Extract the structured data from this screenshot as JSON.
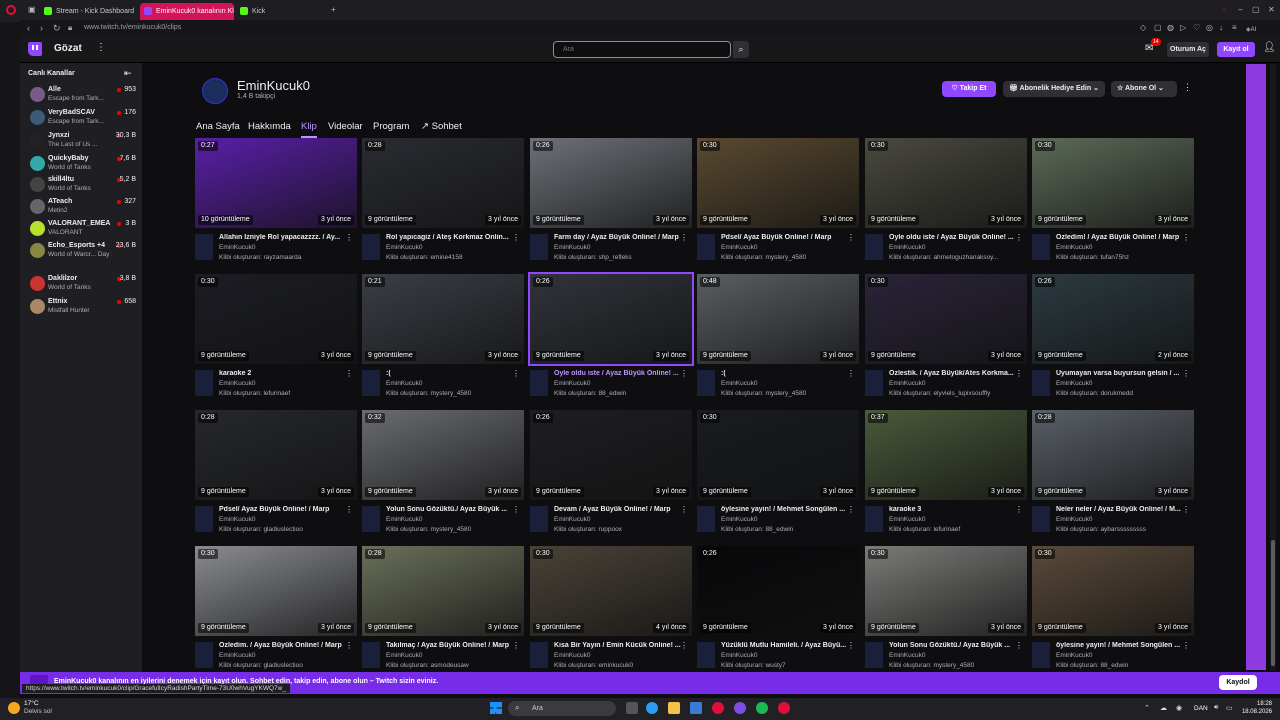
{
  "browser": {
    "tabs": [
      {
        "label": "Stream - Kick Dashboard",
        "color": "#53fc18"
      },
      {
        "label": "EminKucuk0 kanalının Klip",
        "color": "#9147ff",
        "active": true
      },
      {
        "label": "Kick",
        "color": "#53fc18"
      }
    ],
    "new_tab_icon": "+",
    "url": "www.twitch.tv/eminkucuk0/clips",
    "status_url": "https://www.twitch.tv/eminkucuk0/clip/GracefulIcyRadishPartyTime-73U0whVugYKWQ7w_"
  },
  "nav": {
    "browse_label": "Gözat",
    "search_placeholder": "Ara",
    "inbox_badge": "14",
    "login_label": "Oturum Aç",
    "signup_label": "Kayıt ol"
  },
  "sidebar": {
    "title": "Canlı Kanallar",
    "channels": [
      {
        "name": "Alle",
        "game": "Escape from Tark...",
        "viewers": "953",
        "color": "#7a5a8a"
      },
      {
        "name": "VeryBadSCAV",
        "game": "Escape from Tark...",
        "viewers": "176",
        "color": "#3c5a7a"
      },
      {
        "name": "Jynxzi",
        "game": "The Last of Us ...",
        "viewers": "30,3 B",
        "color": "#222"
      },
      {
        "name": "QuickyBaby",
        "game": "World of Tanks",
        "viewers": "7,6 B",
        "color": "#3aa"
      },
      {
        "name": "skill4ltu",
        "game": "World of Tanks",
        "viewers": "5,2 B",
        "color": "#444"
      },
      {
        "name": "ATeach",
        "game": "Metin2",
        "viewers": "327",
        "color": "#666"
      },
      {
        "name": "VALORANT_EMEA",
        "game": "VALORANT",
        "viewers": "3 B",
        "color": "#b6e22c"
      },
      {
        "name": "Echo_Esports +4",
        "game": "World of Warcr... Day 1 - The Ra...",
        "viewers": "23,6 B",
        "color": "#884"
      },
      {
        "name": "Daklilzor",
        "game": "World of Tanks",
        "viewers": "3,8 B",
        "color": "#c33"
      },
      {
        "name": "Ettnix",
        "game": "Mistfall Hunter",
        "viewers": "658",
        "color": "#a86"
      }
    ]
  },
  "channel": {
    "name": "EminKucuk0",
    "followers": "1,4 B takipçi",
    "follow_label": "Takip Et",
    "gift_label": "Abonelik Hediye Edin",
    "subscribe_label": "Abone Ol",
    "tabs": [
      "Ana Sayfa",
      "Hakkımda",
      "Klip",
      "Videolar",
      "Program",
      "Sohbet"
    ]
  },
  "clips": [
    {
      "dur": "0:27",
      "views": "10 görüntüleme",
      "age": "3 yıl önce",
      "title": "Allahın İzniyle Rol yapacazzzz. / Ay...",
      "channel": "EminKucuk0",
      "by": "Klibi oluşturan: rayzamaarda",
      "bg": "#5a1fa8"
    },
    {
      "dur": "0:28",
      "views": "9 görüntüleme",
      "age": "3 yıl önce",
      "title": "Rol yapıcagiz / Ateş Korkmaz Onlin...",
      "channel": "EminKucuk0",
      "by": "Klibi oluşturan: emine4158",
      "bg": "#2a2c32"
    },
    {
      "dur": "0:26",
      "views": "9 görüntüleme",
      "age": "3 yıl önce",
      "title": "Farm day / Ayaz Büyük Online! / Marp",
      "channel": "EminKucuk0",
      "by": "Klibi oluşturan: shp_refleks",
      "bg": "#6d7178"
    },
    {
      "dur": "0:30",
      "views": "9 görüntüleme",
      "age": "3 yıl önce",
      "title": "Pdsel/ Ayaz Büyük Online! / Marp",
      "channel": "EminKucuk0",
      "by": "Klibi oluşturan: mystery_4580",
      "bg": "#5a4a30"
    },
    {
      "dur": "0:30",
      "views": "9 görüntüleme",
      "age": "3 yıl önce",
      "title": "Öyle oldu iste / Ayaz Büyük Online! ...",
      "channel": "EminKucuk0",
      "by": "Klibi oluşturan: ahmetoguzhanaksoy...",
      "bg": "#4a4a40"
    },
    {
      "dur": "0:30",
      "views": "9 görüntüleme",
      "age": "3 yıl önce",
      "title": "Özledim! / Ayaz Büyük Online! / Marp",
      "channel": "EminKucuk0",
      "by": "Klibi oluşturan: tufan75hz",
      "bg": "#5c6a58"
    },
    {
      "dur": "0:30",
      "views": "9 görüntüleme",
      "age": "3 yıl önce",
      "title": "karaoke 2",
      "channel": "EminKucuk0",
      "by": "Klibi oluşturan: lefurinaef",
      "bg": "#1c1d24"
    },
    {
      "dur": "0:21",
      "views": "9 görüntüleme",
      "age": "3 yıl önce",
      "title": ":(",
      "channel": "EminKucuk0",
      "by": "Klibi oluşturan: mystery_4580",
      "bg": "#3a3e46"
    },
    {
      "dur": "0:26",
      "views": "9 görüntüleme",
      "age": "3 yıl önce",
      "title": "Öyle oldu iste / Ayaz Büyük Online! ...",
      "channel": "EminKucuk0",
      "by": "Klibi oluşturan: 88_edwin",
      "bg": "#30343a",
      "highlight": true
    },
    {
      "dur": "0:48",
      "views": "9 görüntüleme",
      "age": "3 yıl önce",
      "title": ":(",
      "channel": "EminKucuk0",
      "by": "Klibi oluşturan: mystery_4580",
      "bg": "#5a5e62"
    },
    {
      "dur": "0:30",
      "views": "9 görüntüleme",
      "age": "3 yıl önce",
      "title": "Özlestik. / Ayaz Büyük/Ates Korkma...",
      "channel": "EminKucuk0",
      "by": "Klibi oluşturan: elyviels_lupixsouffly",
      "bg": "#2a2438"
    },
    {
      "dur": "0:26",
      "views": "9 görüntüleme",
      "age": "2 yıl önce",
      "title": "Uyumayan varsa buyursun gelsin / ...",
      "channel": "EminKucuk0",
      "by": "Klibi oluşturan: dorukmedd",
      "bg": "#2c3a40"
    },
    {
      "dur": "0:28",
      "views": "9 görüntüleme",
      "age": "3 yıl önce",
      "title": "Pdsel/ Ayaz Büyük Online! / Marp",
      "channel": "EminKucuk0",
      "by": "Klibi oluşturan: gladiuslectioo",
      "bg": "#26282c"
    },
    {
      "dur": "0:32",
      "views": "9 görüntüleme",
      "age": "3 yıl önce",
      "title": "Yolun Sonu Gözüktü./ Ayaz Büyük ...",
      "channel": "EminKucuk0",
      "by": "Klibi oluşturan: mystery_4580",
      "bg": "#6a6c70"
    },
    {
      "dur": "0:26",
      "views": "9 görüntüleme",
      "age": "3 yıl önce",
      "title": "Devam / Ayaz Büyük Online! / Marp",
      "channel": "EminKucuk0",
      "by": "Klibi oluşturan: ruppoox",
      "bg": "#1e1e22"
    },
    {
      "dur": "0:30",
      "views": "9 görüntüleme",
      "age": "3 yıl önce",
      "title": "öylesine yayin! / Mehmet Songülen ...",
      "channel": "EminKucuk0",
      "by": "Klibi oluşturan: 88_edwin",
      "bg": "#181c20"
    },
    {
      "dur": "0:37",
      "views": "9 görüntüleme",
      "age": "3 yıl önce",
      "title": "karaoke 3",
      "channel": "EminKucuk0",
      "by": "Klibi oluşturan: lefurinaef",
      "bg": "#4a5a3a"
    },
    {
      "dur": "0:28",
      "views": "9 görüntüleme",
      "age": "3 yıl önce",
      "title": "Neler neler / Ayaz Büyük Online! / M...",
      "channel": "EminKucuk0",
      "by": "Klibi oluşturan: aybarsssssssss",
      "bg": "#5a6068"
    },
    {
      "dur": "0:30",
      "views": "9 görüntüleme",
      "age": "3 yıl önce",
      "title": "Özledim. / Ayaz Büyük Online! / Marp",
      "channel": "EminKucuk0",
      "by": "Klibi oluşturan: gladiuslectioo",
      "bg": "#8a8c90"
    },
    {
      "dur": "0:28",
      "views": "9 görüntüleme",
      "age": "3 yıl önce",
      "title": "Takılmaç / Ayaz Büyük Online! / Marp",
      "channel": "EminKucuk0",
      "by": "Klibi oluşturan: asmodeusaw",
      "bg": "#6a705a"
    },
    {
      "dur": "0:30",
      "views": "9 görüntüleme",
      "age": "4 yıl önce",
      "title": "Kısa Bir Yayın / Emin Kücük Online! ...",
      "channel": "EminKucuk0",
      "by": "Klibi oluşturan: eminkucuk0",
      "bg": "#4a4238"
    },
    {
      "dur": "0:26",
      "views": "9 görüntüleme",
      "age": "3 yıl önce",
      "title": "Yüzüklü Mutlu Hamileli. / Ayaz Büyü...",
      "channel": "EminKucuk0",
      "by": "Klibi oluşturan: wusty7",
      "bg": "#08080a"
    },
    {
      "dur": "0:30",
      "views": "9 görüntüleme",
      "age": "3 yıl önce",
      "title": "Yolun Sonu Gözüktü./ Ayaz Büyük ...",
      "channel": "EminKucuk0",
      "by": "Klibi oluşturan: mystery_4580",
      "bg": "#7a7c78"
    },
    {
      "dur": "0:30",
      "views": "9 görüntüleme",
      "age": "3 yıl önce",
      "title": "öylesine yayin! / Mehmet Songülen ...",
      "channel": "EminKucuk0",
      "by": "Klibi oluşturan: 88_edwin",
      "bg": "#5a4a3a"
    }
  ],
  "banner": {
    "text": "EminKucuk0 kanalının en iyilerini denemek için kayıt olun. Sohbet edin, takip edin, abone olun – Twitch sizin eviniz.",
    "button": "Kaydol"
  },
  "taskbar": {
    "temp": "17°C",
    "weather": "Delvis sol",
    "search": "Ara",
    "lang": "DAN",
    "time": "18:28",
    "date": "18.08.2026"
  }
}
